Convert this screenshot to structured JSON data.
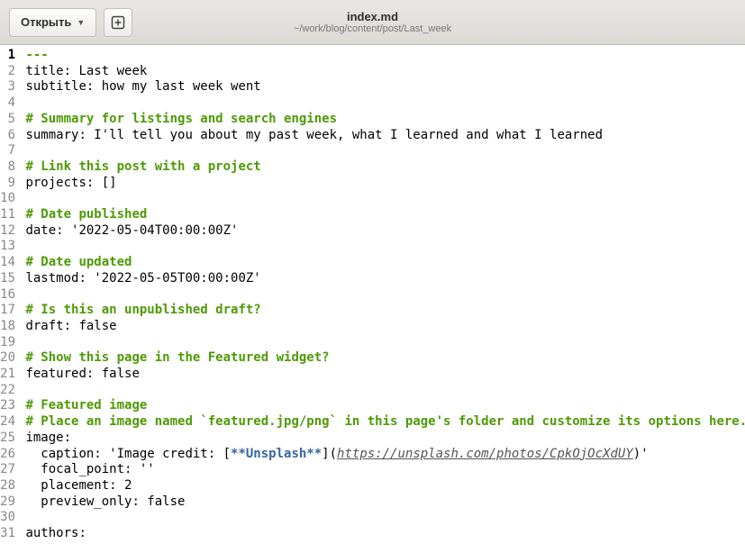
{
  "titlebar": {
    "open_label": "Открыть",
    "filename": "index.md",
    "path": "~/work/blog/content/post/Last_week"
  },
  "editor": {
    "current_line": 1,
    "lines": [
      [
        {
          "c": "fm-delim",
          "t": "---"
        }
      ],
      [
        {
          "c": "txt",
          "t": "title: Last week"
        }
      ],
      [
        {
          "c": "txt",
          "t": "subtitle: how my last week went"
        }
      ],
      [],
      [
        {
          "c": "cmt",
          "t": "# Summary for listings and search engines"
        }
      ],
      [
        {
          "c": "txt",
          "t": "summary: I'll tell you about my past week, what I learned and what I learned"
        }
      ],
      [],
      [
        {
          "c": "cmt",
          "t": "# Link this post with a project"
        }
      ],
      [
        {
          "c": "txt",
          "t": "projects: []"
        }
      ],
      [],
      [
        {
          "c": "cmt",
          "t": "# Date published"
        }
      ],
      [
        {
          "c": "txt",
          "t": "date: '2022-05-04T00:00:00Z'"
        }
      ],
      [],
      [
        {
          "c": "cmt",
          "t": "# Date updated"
        }
      ],
      [
        {
          "c": "txt",
          "t": "lastmod: '2022-05-05T00:00:00Z'"
        }
      ],
      [],
      [
        {
          "c": "cmt",
          "t": "# Is this an unpublished draft?"
        }
      ],
      [
        {
          "c": "txt",
          "t": "draft: false"
        }
      ],
      [],
      [
        {
          "c": "cmt",
          "t": "# Show this page in the Featured widget?"
        }
      ],
      [
        {
          "c": "txt",
          "t": "featured: false"
        }
      ],
      [],
      [
        {
          "c": "cmt",
          "t": "# Featured image"
        }
      ],
      [
        {
          "c": "cmt",
          "t": "# Place an image named `featured.jpg/png` in this page's folder and customize its options here."
        }
      ],
      [
        {
          "c": "txt",
          "t": "image:"
        }
      ],
      [
        {
          "c": "txt",
          "t": "  caption: 'Image credit: ["
        },
        {
          "c": "bold-blue",
          "t": "**Unsplash**"
        },
        {
          "c": "txt",
          "t": "]("
        },
        {
          "c": "link-ital",
          "t": "https://unsplash.com/photos/CpkOjOcXdUY"
        },
        {
          "c": "txt",
          "t": ")'"
        }
      ],
      [
        {
          "c": "txt",
          "t": "  focal_point: ''"
        }
      ],
      [
        {
          "c": "txt",
          "t": "  placement: 2"
        }
      ],
      [
        {
          "c": "txt",
          "t": "  preview_only: false"
        }
      ],
      [],
      [
        {
          "c": "txt",
          "t": "authors:"
        }
      ]
    ]
  }
}
